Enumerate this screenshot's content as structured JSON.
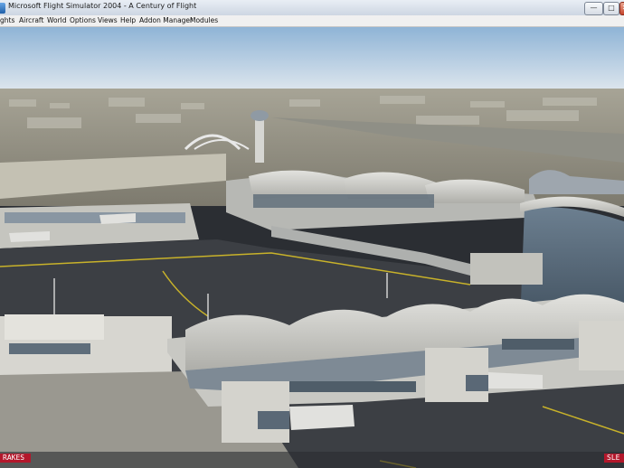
{
  "window": {
    "title": "Microsoft Flight Simulator 2004 - A Century of Flight",
    "buttons": {
      "minimize": "—",
      "maximize": "□",
      "close": "✕"
    }
  },
  "menu": {
    "items": [
      "ghts",
      "Aircraft",
      "World",
      "Options",
      "Views",
      "Help",
      "Addon Manager",
      "Modules"
    ]
  },
  "status": {
    "left": "RAKES",
    "right": "SLE"
  },
  "colors": {
    "sky_top": "#8fb4d6",
    "sky_horizon": "#dfe7ee",
    "tarmac": "#3c3f44",
    "terminal_roof": "#c9c9c5",
    "status_bg": "#b3172b"
  }
}
